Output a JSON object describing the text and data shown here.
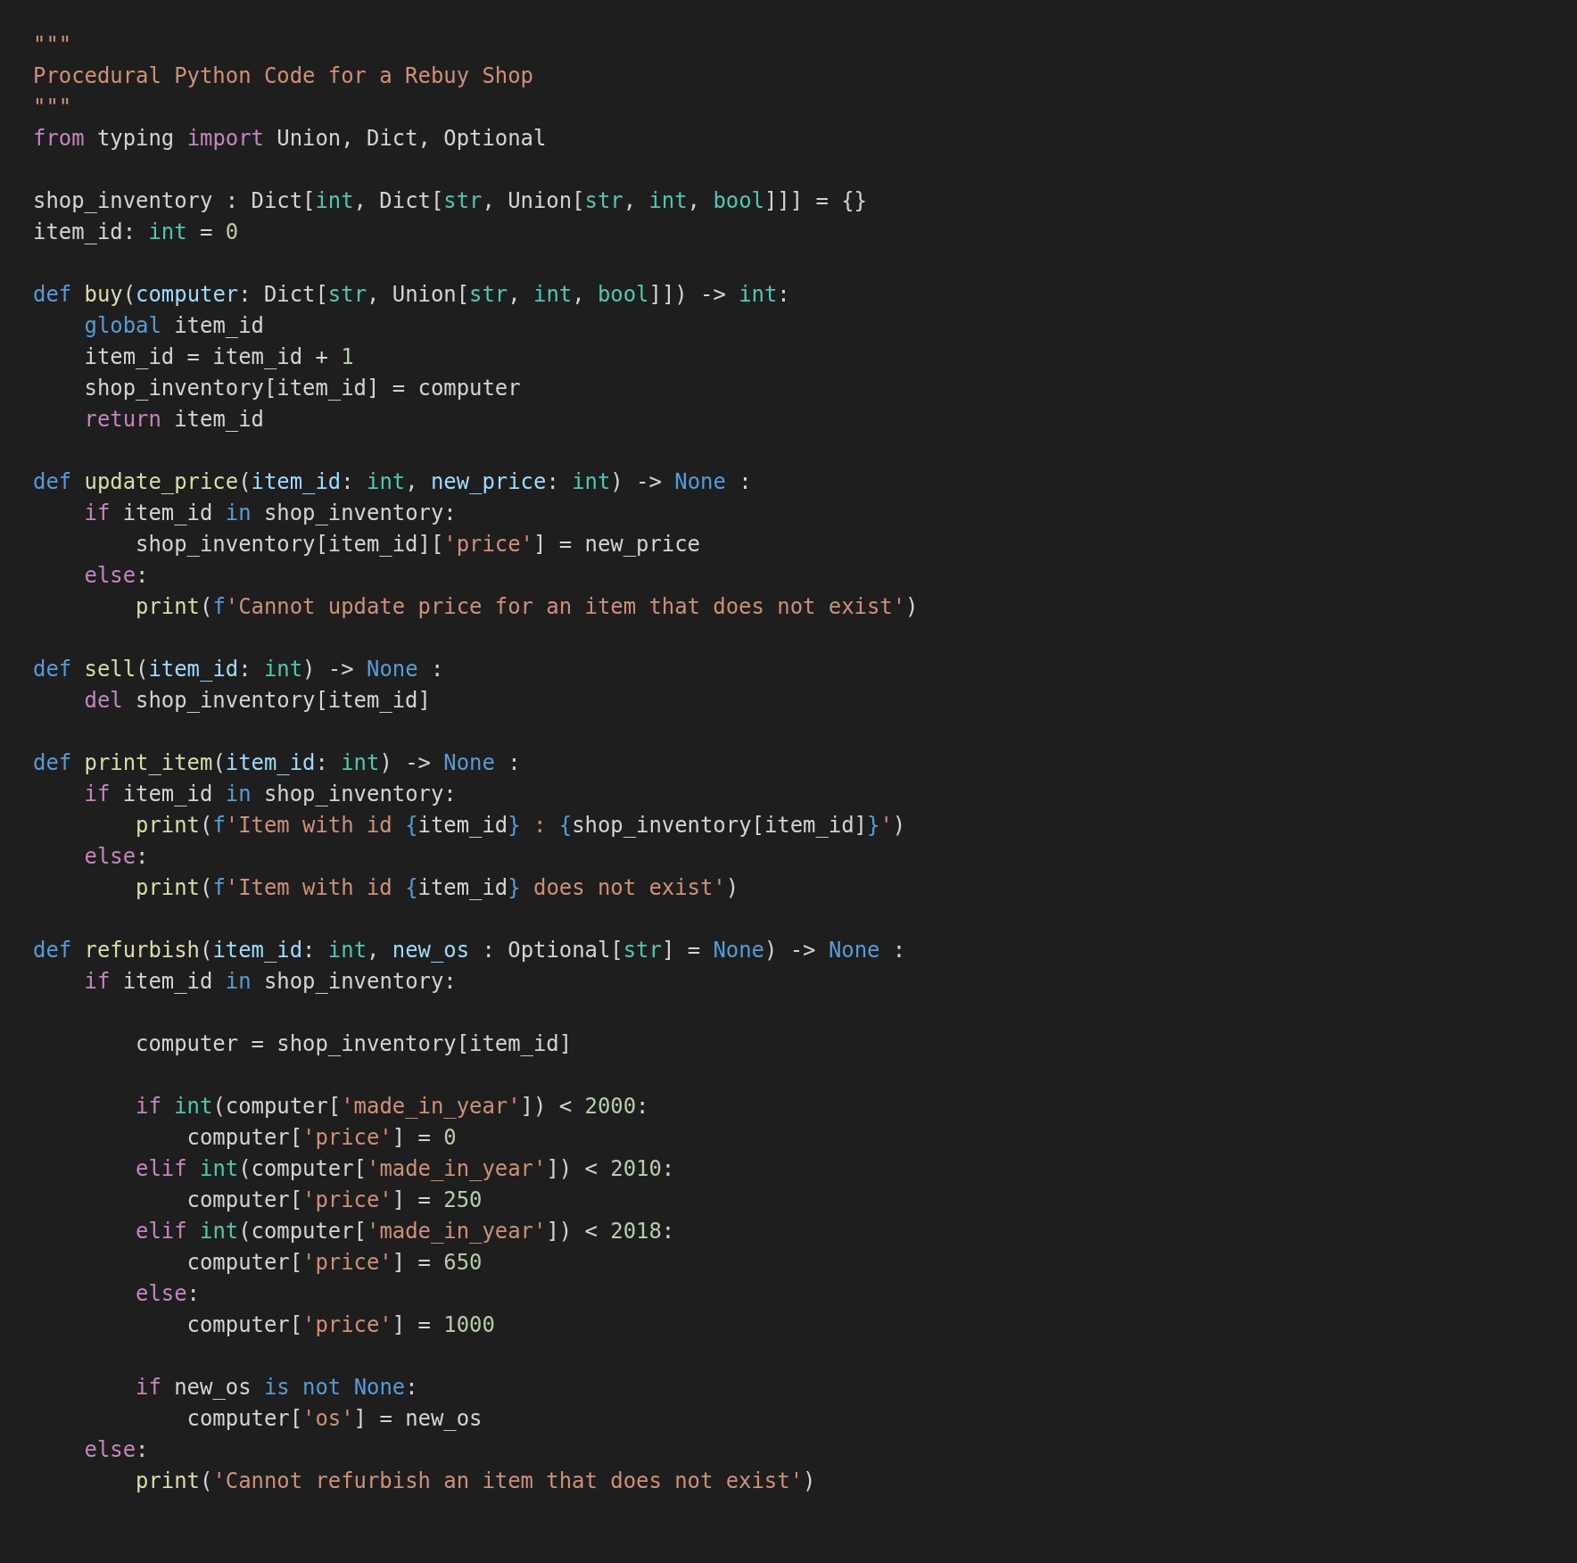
{
  "code_lines": [
    {
      "gap_before": false,
      "tokens": [
        {
          "kind": "string",
          "text": "\"\"\""
        }
      ]
    },
    {
      "gap_before": false,
      "tokens": [
        {
          "kind": "string",
          "text": "Procedural Python Code for a Rebuy Shop"
        }
      ]
    },
    {
      "gap_before": false,
      "tokens": [
        {
          "kind": "string",
          "text": "\"\"\""
        }
      ]
    },
    {
      "gap_before": false,
      "tokens": [
        {
          "kind": "control",
          "text": "from"
        },
        {
          "kind": "plain",
          "text": " typing "
        },
        {
          "kind": "control",
          "text": "import"
        },
        {
          "kind": "plain",
          "text": " Union, Dict, Optional"
        }
      ]
    },
    {
      "gap_before": true,
      "tokens": [
        {
          "kind": "plain",
          "text": "shop_inventory : Dict["
        },
        {
          "kind": "type",
          "text": "int"
        },
        {
          "kind": "plain",
          "text": ", Dict["
        },
        {
          "kind": "type",
          "text": "str"
        },
        {
          "kind": "plain",
          "text": ", Union["
        },
        {
          "kind": "type",
          "text": "str"
        },
        {
          "kind": "plain",
          "text": ", "
        },
        {
          "kind": "type",
          "text": "int"
        },
        {
          "kind": "plain",
          "text": ", "
        },
        {
          "kind": "type",
          "text": "bool"
        },
        {
          "kind": "plain",
          "text": "]]] = {}"
        }
      ]
    },
    {
      "gap_before": false,
      "tokens": [
        {
          "kind": "plain",
          "text": "item_id: "
        },
        {
          "kind": "type",
          "text": "int"
        },
        {
          "kind": "plain",
          "text": " = "
        },
        {
          "kind": "number",
          "text": "0"
        }
      ]
    },
    {
      "gap_before": true,
      "tokens": [
        {
          "kind": "storage",
          "text": "def"
        },
        {
          "kind": "function",
          "text": " buy"
        },
        {
          "kind": "plain",
          "text": "("
        },
        {
          "kind": "param",
          "text": "computer"
        },
        {
          "kind": "plain",
          "text": ": Dict["
        },
        {
          "kind": "type",
          "text": "str"
        },
        {
          "kind": "plain",
          "text": ", Union["
        },
        {
          "kind": "type",
          "text": "str"
        },
        {
          "kind": "plain",
          "text": ", "
        },
        {
          "kind": "type",
          "text": "int"
        },
        {
          "kind": "plain",
          "text": ", "
        },
        {
          "kind": "type",
          "text": "bool"
        },
        {
          "kind": "plain",
          "text": "]]) -> "
        },
        {
          "kind": "type",
          "text": "int"
        },
        {
          "kind": "plain",
          "text": ":"
        }
      ]
    },
    {
      "gap_before": false,
      "tokens": [
        {
          "kind": "storage",
          "text": "    global"
        },
        {
          "kind": "plain",
          "text": " item_id"
        }
      ]
    },
    {
      "gap_before": false,
      "tokens": [
        {
          "kind": "plain",
          "text": "    item_id = item_id + "
        },
        {
          "kind": "number",
          "text": "1"
        }
      ]
    },
    {
      "gap_before": false,
      "tokens": [
        {
          "kind": "plain",
          "text": "    shop_inventory[item_id] = computer"
        }
      ]
    },
    {
      "gap_before": false,
      "tokens": [
        {
          "kind": "control",
          "text": "    return"
        },
        {
          "kind": "plain",
          "text": " item_id"
        }
      ]
    },
    {
      "gap_before": true,
      "tokens": [
        {
          "kind": "storage",
          "text": "def"
        },
        {
          "kind": "function",
          "text": " update_price"
        },
        {
          "kind": "plain",
          "text": "("
        },
        {
          "kind": "param",
          "text": "item_id"
        },
        {
          "kind": "plain",
          "text": ": "
        },
        {
          "kind": "type",
          "text": "int"
        },
        {
          "kind": "plain",
          "text": ", "
        },
        {
          "kind": "param",
          "text": "new_price"
        },
        {
          "kind": "plain",
          "text": ": "
        },
        {
          "kind": "type",
          "text": "int"
        },
        {
          "kind": "plain",
          "text": ") -> "
        },
        {
          "kind": "storage",
          "text": "None"
        },
        {
          "kind": "plain",
          "text": " :"
        }
      ]
    },
    {
      "gap_before": false,
      "tokens": [
        {
          "kind": "control",
          "text": "    if"
        },
        {
          "kind": "plain",
          "text": " item_id "
        },
        {
          "kind": "storage",
          "text": "in"
        },
        {
          "kind": "plain",
          "text": " shop_inventory:"
        }
      ]
    },
    {
      "gap_before": false,
      "tokens": [
        {
          "kind": "plain",
          "text": "        shop_inventory[item_id]["
        },
        {
          "kind": "string",
          "text": "'price'"
        },
        {
          "kind": "plain",
          "text": "] = new_price"
        }
      ]
    },
    {
      "gap_before": false,
      "tokens": [
        {
          "kind": "control",
          "text": "    else"
        },
        {
          "kind": "plain",
          "text": ":"
        }
      ]
    },
    {
      "gap_before": false,
      "tokens": [
        {
          "kind": "function",
          "text": "        print"
        },
        {
          "kind": "plain",
          "text": "("
        },
        {
          "kind": "storage",
          "text": "f"
        },
        {
          "kind": "string",
          "text": "'Cannot update price for an item that does not exist'"
        },
        {
          "kind": "plain",
          "text": ")"
        }
      ]
    },
    {
      "gap_before": true,
      "tokens": [
        {
          "kind": "storage",
          "text": "def"
        },
        {
          "kind": "function",
          "text": " sell"
        },
        {
          "kind": "plain",
          "text": "("
        },
        {
          "kind": "param",
          "text": "item_id"
        },
        {
          "kind": "plain",
          "text": ": "
        },
        {
          "kind": "type",
          "text": "int"
        },
        {
          "kind": "plain",
          "text": ") -> "
        },
        {
          "kind": "storage",
          "text": "None"
        },
        {
          "kind": "plain",
          "text": " :"
        }
      ]
    },
    {
      "gap_before": false,
      "tokens": [
        {
          "kind": "control",
          "text": "    del"
        },
        {
          "kind": "plain",
          "text": " shop_inventory[item_id]"
        }
      ]
    },
    {
      "gap_before": true,
      "tokens": [
        {
          "kind": "storage",
          "text": "def"
        },
        {
          "kind": "function",
          "text": " print_item"
        },
        {
          "kind": "plain",
          "text": "("
        },
        {
          "kind": "param",
          "text": "item_id"
        },
        {
          "kind": "plain",
          "text": ": "
        },
        {
          "kind": "type",
          "text": "int"
        },
        {
          "kind": "plain",
          "text": ") -> "
        },
        {
          "kind": "storage",
          "text": "None"
        },
        {
          "kind": "plain",
          "text": " :"
        }
      ]
    },
    {
      "gap_before": false,
      "tokens": [
        {
          "kind": "control",
          "text": "    if"
        },
        {
          "kind": "plain",
          "text": " item_id "
        },
        {
          "kind": "storage",
          "text": "in"
        },
        {
          "kind": "plain",
          "text": " shop_inventory:"
        }
      ]
    },
    {
      "gap_before": false,
      "tokens": [
        {
          "kind": "function",
          "text": "        print"
        },
        {
          "kind": "plain",
          "text": "("
        },
        {
          "kind": "storage",
          "text": "f"
        },
        {
          "kind": "string",
          "text": "'Item with id "
        },
        {
          "kind": "storage",
          "text": "{"
        },
        {
          "kind": "plain",
          "text": "item_id"
        },
        {
          "kind": "storage",
          "text": "}"
        },
        {
          "kind": "string",
          "text": " : "
        },
        {
          "kind": "storage",
          "text": "{"
        },
        {
          "kind": "plain",
          "text": "shop_inventory[item_id]"
        },
        {
          "kind": "storage",
          "text": "}"
        },
        {
          "kind": "string",
          "text": "'"
        },
        {
          "kind": "plain",
          "text": ")"
        }
      ]
    },
    {
      "gap_before": false,
      "tokens": [
        {
          "kind": "control",
          "text": "    else"
        },
        {
          "kind": "plain",
          "text": ":"
        }
      ]
    },
    {
      "gap_before": false,
      "tokens": [
        {
          "kind": "function",
          "text": "        print"
        },
        {
          "kind": "plain",
          "text": "("
        },
        {
          "kind": "storage",
          "text": "f"
        },
        {
          "kind": "string",
          "text": "'Item with id "
        },
        {
          "kind": "storage",
          "text": "{"
        },
        {
          "kind": "plain",
          "text": "item_id"
        },
        {
          "kind": "storage",
          "text": "}"
        },
        {
          "kind": "string",
          "text": " does not exist'"
        },
        {
          "kind": "plain",
          "text": ")"
        }
      ]
    },
    {
      "gap_before": true,
      "tokens": [
        {
          "kind": "storage",
          "text": "def"
        },
        {
          "kind": "function",
          "text": " refurbish"
        },
        {
          "kind": "plain",
          "text": "("
        },
        {
          "kind": "param",
          "text": "item_id"
        },
        {
          "kind": "plain",
          "text": ": "
        },
        {
          "kind": "type",
          "text": "int"
        },
        {
          "kind": "plain",
          "text": ", "
        },
        {
          "kind": "param",
          "text": "new_os"
        },
        {
          "kind": "plain",
          "text": " : Optional["
        },
        {
          "kind": "type",
          "text": "str"
        },
        {
          "kind": "plain",
          "text": "] = "
        },
        {
          "kind": "storage",
          "text": "None"
        },
        {
          "kind": "plain",
          "text": ") -> "
        },
        {
          "kind": "storage",
          "text": "None"
        },
        {
          "kind": "plain",
          "text": " :"
        }
      ]
    },
    {
      "gap_before": false,
      "tokens": [
        {
          "kind": "control",
          "text": "    if"
        },
        {
          "kind": "plain",
          "text": " item_id "
        },
        {
          "kind": "storage",
          "text": "in"
        },
        {
          "kind": "plain",
          "text": " shop_inventory:"
        }
      ]
    },
    {
      "gap_before": true,
      "tokens": [
        {
          "kind": "plain",
          "text": "        computer = shop_inventory[item_id]"
        }
      ]
    },
    {
      "gap_before": true,
      "tokens": [
        {
          "kind": "control",
          "text": "        if"
        },
        {
          "kind": "type",
          "text": " int"
        },
        {
          "kind": "plain",
          "text": "(computer["
        },
        {
          "kind": "string",
          "text": "'made_in_year'"
        },
        {
          "kind": "plain",
          "text": "]) < "
        },
        {
          "kind": "number",
          "text": "2000"
        },
        {
          "kind": "plain",
          "text": ":"
        }
      ]
    },
    {
      "gap_before": false,
      "tokens": [
        {
          "kind": "plain",
          "text": "            computer["
        },
        {
          "kind": "string",
          "text": "'price'"
        },
        {
          "kind": "plain",
          "text": "] = "
        },
        {
          "kind": "number",
          "text": "0"
        }
      ]
    },
    {
      "gap_before": false,
      "tokens": [
        {
          "kind": "control",
          "text": "        elif"
        },
        {
          "kind": "type",
          "text": " int"
        },
        {
          "kind": "plain",
          "text": "(computer["
        },
        {
          "kind": "string",
          "text": "'made_in_year'"
        },
        {
          "kind": "plain",
          "text": "]) < "
        },
        {
          "kind": "number",
          "text": "2010"
        },
        {
          "kind": "plain",
          "text": ":"
        }
      ]
    },
    {
      "gap_before": false,
      "tokens": [
        {
          "kind": "plain",
          "text": "            computer["
        },
        {
          "kind": "string",
          "text": "'price'"
        },
        {
          "kind": "plain",
          "text": "] = "
        },
        {
          "kind": "number",
          "text": "250"
        }
      ]
    },
    {
      "gap_before": false,
      "tokens": [
        {
          "kind": "control",
          "text": "        elif"
        },
        {
          "kind": "type",
          "text": " int"
        },
        {
          "kind": "plain",
          "text": "(computer["
        },
        {
          "kind": "string",
          "text": "'made_in_year'"
        },
        {
          "kind": "plain",
          "text": "]) < "
        },
        {
          "kind": "number",
          "text": "2018"
        },
        {
          "kind": "plain",
          "text": ":"
        }
      ]
    },
    {
      "gap_before": false,
      "tokens": [
        {
          "kind": "plain",
          "text": "            computer["
        },
        {
          "kind": "string",
          "text": "'price'"
        },
        {
          "kind": "plain",
          "text": "] = "
        },
        {
          "kind": "number",
          "text": "650"
        }
      ]
    },
    {
      "gap_before": false,
      "tokens": [
        {
          "kind": "control",
          "text": "        else"
        },
        {
          "kind": "plain",
          "text": ":"
        }
      ]
    },
    {
      "gap_before": false,
      "tokens": [
        {
          "kind": "plain",
          "text": "            computer["
        },
        {
          "kind": "string",
          "text": "'price'"
        },
        {
          "kind": "plain",
          "text": "] = "
        },
        {
          "kind": "number",
          "text": "1000"
        }
      ]
    },
    {
      "gap_before": true,
      "tokens": [
        {
          "kind": "control",
          "text": "        if"
        },
        {
          "kind": "plain",
          "text": " new_os "
        },
        {
          "kind": "storage",
          "text": "is"
        },
        {
          "kind": "storage",
          "text": " not"
        },
        {
          "kind": "storage",
          "text": " None"
        },
        {
          "kind": "plain",
          "text": ":"
        }
      ]
    },
    {
      "gap_before": false,
      "tokens": [
        {
          "kind": "plain",
          "text": "            computer["
        },
        {
          "kind": "string",
          "text": "'os'"
        },
        {
          "kind": "plain",
          "text": "] = new_os"
        }
      ]
    },
    {
      "gap_before": false,
      "tokens": [
        {
          "kind": "control",
          "text": "    else"
        },
        {
          "kind": "plain",
          "text": ":"
        }
      ]
    },
    {
      "gap_before": false,
      "tokens": [
        {
          "kind": "function",
          "text": "        print"
        },
        {
          "kind": "plain",
          "text": "("
        },
        {
          "kind": "string",
          "text": "'Cannot refurbish an item that does not exist'"
        },
        {
          "kind": "plain",
          "text": ")"
        }
      ]
    }
  ]
}
